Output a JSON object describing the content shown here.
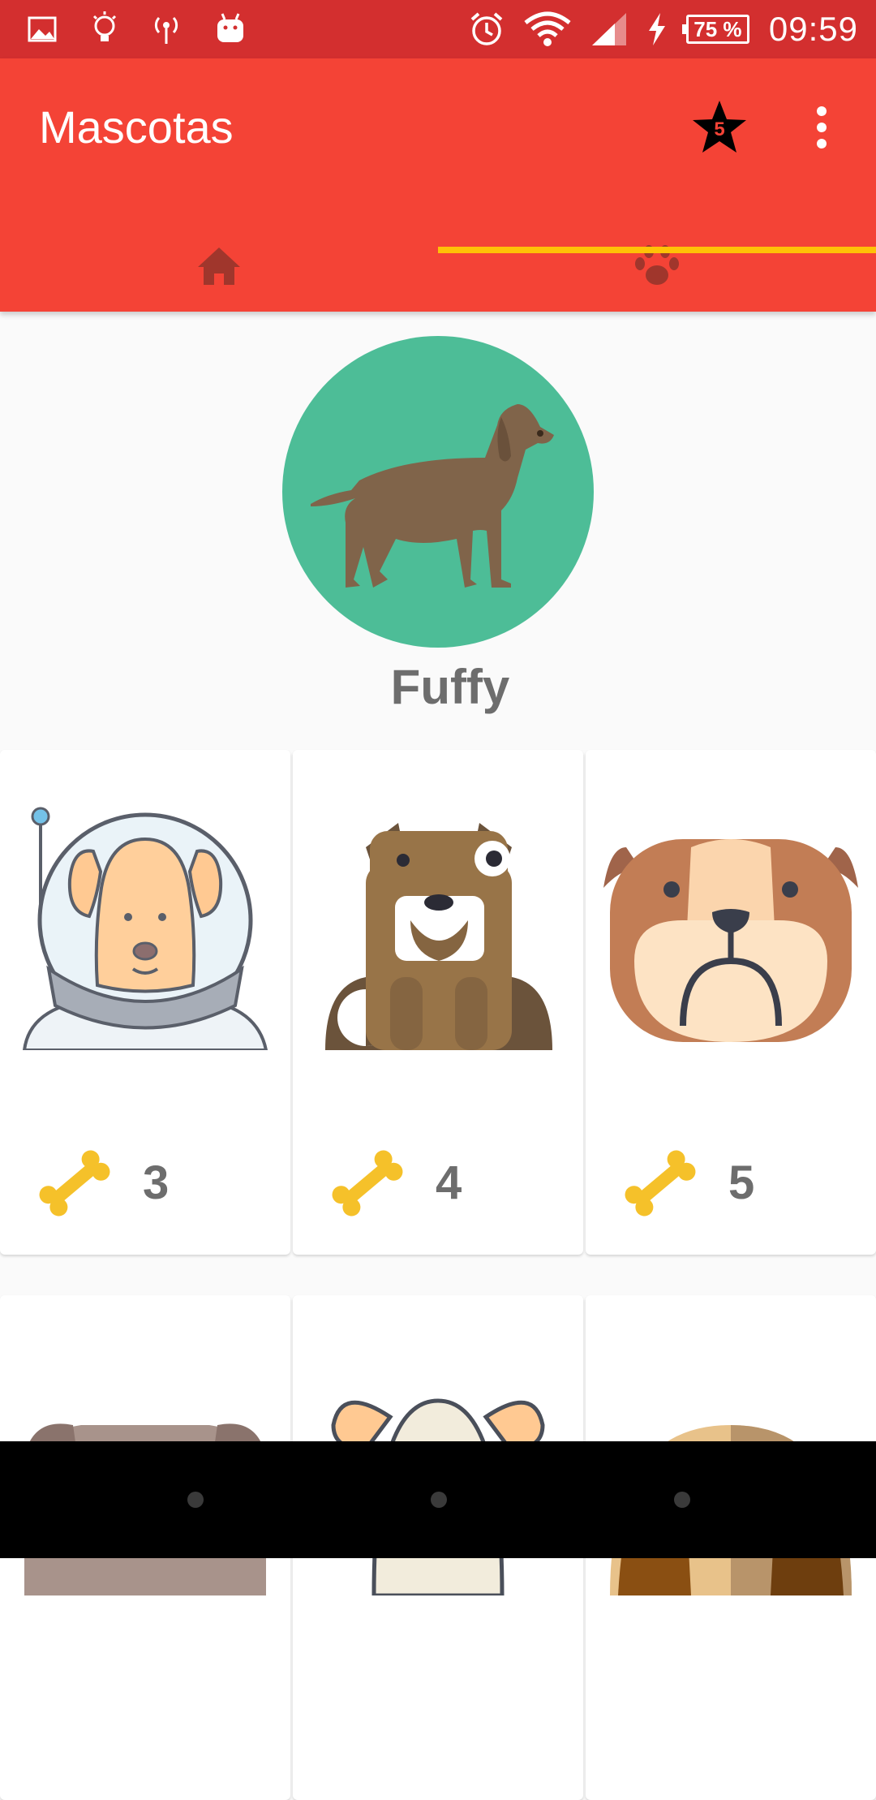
{
  "status_bar": {
    "battery_percent": "75 %",
    "time": "09:59",
    "icons": [
      "image-icon",
      "lightbulb-icon",
      "hotspot-icon",
      "android-icon",
      "alarm-icon",
      "wifi-icon",
      "signal-icon",
      "charging-icon",
      "battery-icon"
    ]
  },
  "app_bar": {
    "title": "Mascotas",
    "star_badge_count": "5",
    "tabs": [
      {
        "icon": "home-icon",
        "selected": false
      },
      {
        "icon": "paw-icon",
        "selected": true
      }
    ],
    "colors": {
      "primary": "#f44336",
      "status": "#d32f2f",
      "indicator": "#ffc107"
    }
  },
  "profile": {
    "name": "Fuffy"
  },
  "pets": [
    {
      "icon": "astronaut-dog-icon",
      "likes": "3"
    },
    {
      "icon": "brown-dog-icon",
      "likes": "4"
    },
    {
      "icon": "bulldog-icon",
      "likes": "5"
    },
    {
      "icon": "gray-dog-icon",
      "likes": ""
    },
    {
      "icon": "bunny-dog-icon",
      "likes": ""
    },
    {
      "icon": "beagle-dog-icon",
      "likes": ""
    }
  ]
}
